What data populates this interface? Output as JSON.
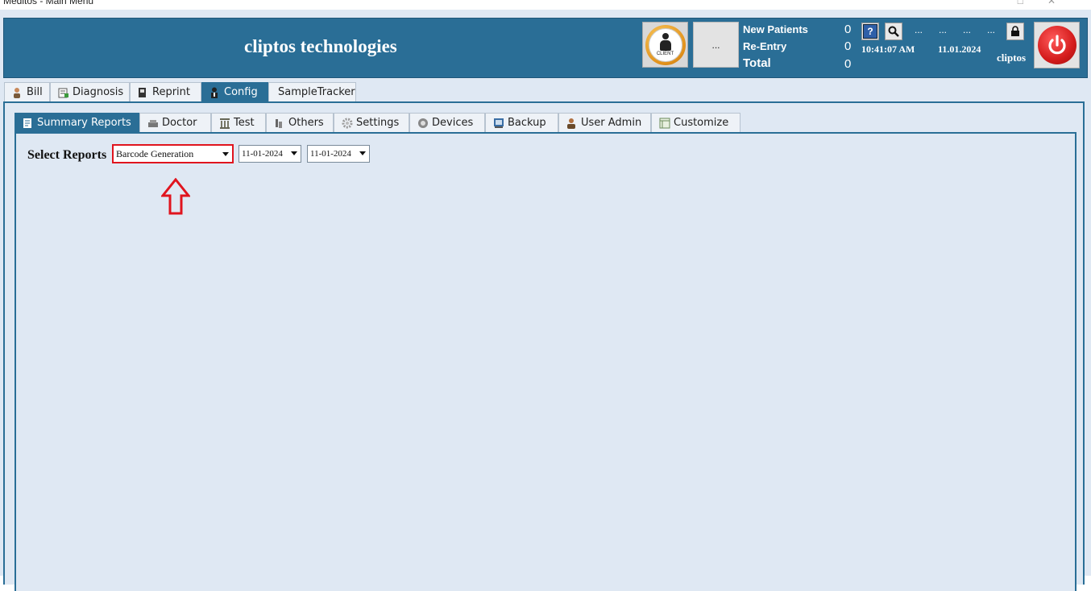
{
  "window": {
    "title": "Meditos - Main Menu",
    "controls": [
      "—",
      "□",
      "✕"
    ]
  },
  "header": {
    "brand": "cliptos technologies",
    "client_badge_label": "CLIENT",
    "dots_button_label": "...",
    "stats": [
      {
        "label": "New Patients",
        "value": "0"
      },
      {
        "label": "Re-Entry",
        "value": "0"
      },
      {
        "label": "Total",
        "value": "0"
      }
    ],
    "ellipses": [
      "...",
      "...",
      "...",
      "..."
    ],
    "time": "10:41:07 AM",
    "date": "11.01.2024",
    "user": "cliptos"
  },
  "main_tabs": [
    {
      "label": "Bill",
      "icon": "person-icon",
      "active": false
    },
    {
      "label": "Diagnosis",
      "icon": "diagnosis-icon",
      "active": false
    },
    {
      "label": "Reprint",
      "icon": "printer-icon",
      "active": false
    },
    {
      "label": "Config",
      "icon": "user-config-icon",
      "active": true
    },
    {
      "label": "SampleTracker",
      "icon": "",
      "active": false
    }
  ],
  "sub_tabs": [
    {
      "label": "Summary Reports",
      "icon": "report-icon",
      "active": true
    },
    {
      "label": "Doctor",
      "icon": "doctor-icon",
      "active": false
    },
    {
      "label": "Test",
      "icon": "test-icon",
      "active": false
    },
    {
      "label": "Others",
      "icon": "others-icon",
      "active": false
    },
    {
      "label": "Settings",
      "icon": "gear-icon",
      "active": false
    },
    {
      "label": "Devices",
      "icon": "device-icon",
      "active": false
    },
    {
      "label": "Backup",
      "icon": "backup-icon",
      "active": false
    },
    {
      "label": "User Admin",
      "icon": "user-admin-icon",
      "active": false
    },
    {
      "label": "Customize",
      "icon": "customize-icon",
      "active": false
    }
  ],
  "summary_reports": {
    "select_label": "Select Reports",
    "report_type": "Barcode Generation",
    "from_date": "11-01-2024",
    "to_date": "11-01-2024"
  },
  "colors": {
    "header_blue": "#2a6e96",
    "panel_bg": "#dfe8f3",
    "highlight_red": "#e0141e"
  }
}
